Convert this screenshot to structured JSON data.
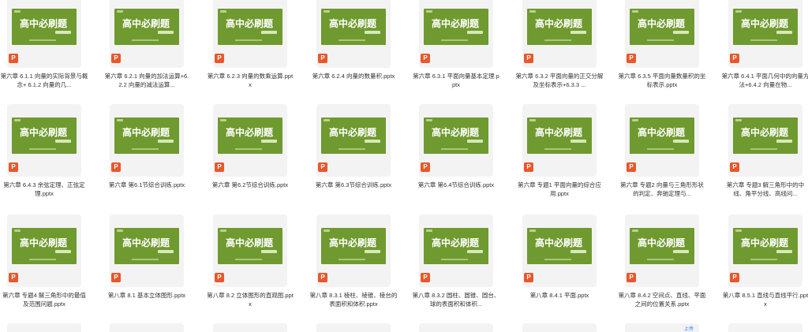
{
  "slide_brand": "高中必刷题",
  "badge_letter": "P",
  "partial_badge": "上传",
  "files": [
    {
      "name": "第六章 6.1.1 向量的实际背景与概念+ 6.1.2 向量的几..."
    },
    {
      "name": "第六章 6.2.1 向量的加法运算+6.2.2 向量的减法运算..."
    },
    {
      "name": "第六章 6.2.3 向量的数乘运算.pptx"
    },
    {
      "name": "第六章 6.2.4 向量的数量积.pptx"
    },
    {
      "name": "第六章 6.3.1 平面向量基本定理.pptx"
    },
    {
      "name": "第六章 6.3.2 平面向量的正交分解及坐标表示+6.3.3 ..."
    },
    {
      "name": "第六章 6.3.5 平面向量数量积的坐标表示.pptx"
    },
    {
      "name": "第六章 6.4.1 平面几何中的向量方法+6.4.2 向量在物..."
    },
    {
      "name": "第六章 6.4.3 余弦定理、正弦定理.pptx"
    },
    {
      "name": "第六章 第6.1节综合训练.pptx"
    },
    {
      "name": "第六章 第6.2节综合训练.pptx"
    },
    {
      "name": "第六章 第6.3节综合训练.pptx"
    },
    {
      "name": "第六章 第6.4节综合训练.pptx"
    },
    {
      "name": "第六章 专题1 平面向量的综合应用.pptx"
    },
    {
      "name": "第六章 专题2 向量与三角形形状的判定、奔驰定理与..."
    },
    {
      "name": "第六章 专题3 解三角形中的中线、角平分线、高线问..."
    },
    {
      "name": "第六章 专题4 解三角形中的最值及范围问题.pptx"
    },
    {
      "name": "第八章 8.1 基本立体图形.pptx"
    },
    {
      "name": "第八章 8.2 立体图形的直观图.pptx"
    },
    {
      "name": "第八章 8.3.1 棱柱、棱锥、棱台的表面积和体积.pptx"
    },
    {
      "name": "第八章 8.3.2 圆柱、圆锥、圆台、球的表面积和体积..."
    },
    {
      "name": "第八章 8.4.1 平面.pptx"
    },
    {
      "name": "第八章 8.4.2 空间点、直线、平面之间的位置关系.pptx"
    },
    {
      "name": "第八章 8.5.1 直线与直线平行.pptx"
    }
  ]
}
